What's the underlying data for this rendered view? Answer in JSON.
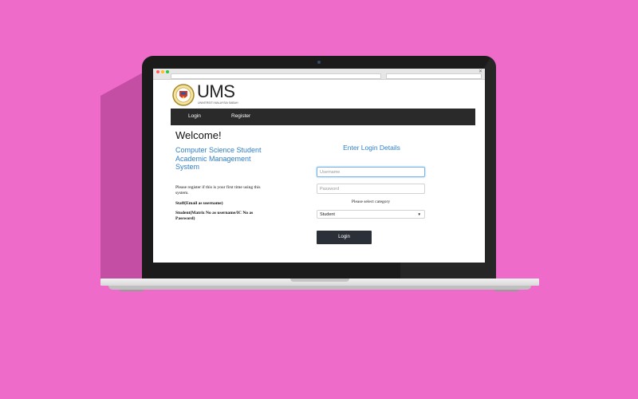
{
  "site": {
    "brand": "UMS",
    "brand_subtitle": "UNIVERSITI MALAYSIA SABAH"
  },
  "nav": {
    "items": [
      {
        "label": "Login"
      },
      {
        "label": "Register"
      }
    ]
  },
  "left": {
    "welcome": "Welcome!",
    "system_title": "Computer Science Student Academic Management System",
    "notes": {
      "first_time": "Please register if this is your first time using this system.",
      "staff": "Staff(Email as username)",
      "student": "Student(Matrix No as username/IC No as Password)"
    }
  },
  "login_form": {
    "heading": "Enter Login Details",
    "username_placeholder": "Username",
    "password_placeholder": "Password",
    "category_label": "Please select category",
    "category_selected": "Student",
    "submit_label": "Login"
  },
  "colors": {
    "background": "#ee6bc9",
    "navbar": "#2a2a2a",
    "accent_text": "#2f7fc7",
    "button": "#2b2f38"
  }
}
